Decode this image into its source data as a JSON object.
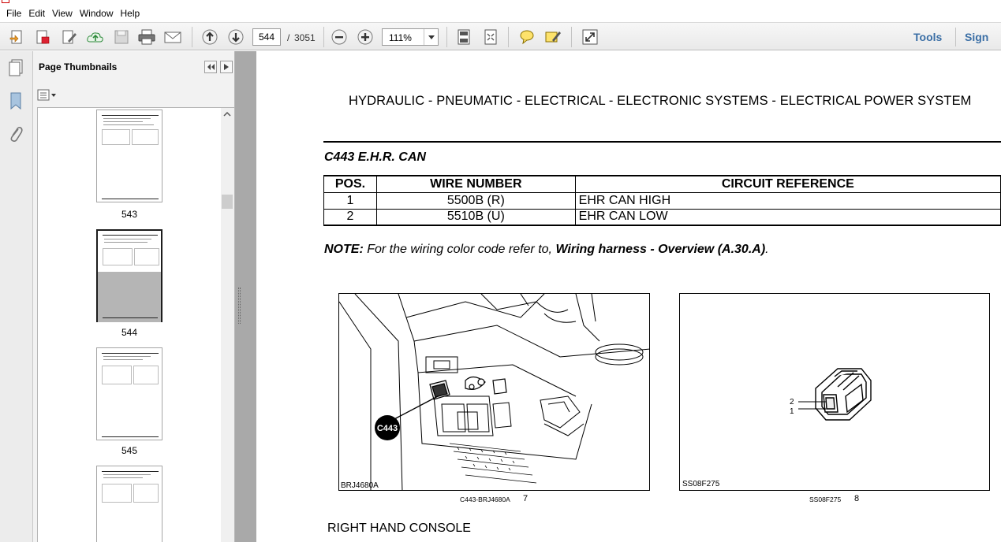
{
  "menu": [
    "File",
    "Edit",
    "View",
    "Window",
    "Help"
  ],
  "toolbar": {
    "current_page": "544",
    "page_separator": "/",
    "total_pages": "3051",
    "zoom": "111%",
    "tools_label": "Tools",
    "sign_label": "Sign"
  },
  "thumbnails": {
    "title": "Page Thumbnails",
    "items": [
      {
        "label": "543",
        "selected": false
      },
      {
        "label": "544",
        "selected": true
      },
      {
        "label": "545",
        "selected": false
      },
      {
        "label": "",
        "selected": false
      }
    ]
  },
  "document": {
    "header": "HYDRAULIC - PNEUMATIC - ELECTRICAL - ELECTRONIC SYSTEMS - ELECTRICAL POWER SYSTEM",
    "connector_title": "C443 E.H.R. CAN",
    "table": {
      "headers": [
        "POS.",
        "WIRE NUMBER",
        "CIRCUIT REFERENCE"
      ],
      "rows": [
        [
          "1",
          "5500B (R)",
          "EHR CAN HIGH"
        ],
        [
          "2",
          "5510B (U)",
          "EHR CAN LOW"
        ]
      ]
    },
    "note": {
      "label": "NOTE:",
      "text": " For the wiring color code refer to, ",
      "link": "Wiring harness - Overview (A.30.A)",
      "end": "."
    },
    "figures": [
      {
        "code": "BRJ4680A",
        "caption": "C443-BRJ4680A",
        "number": "7",
        "callout": "C443"
      },
      {
        "code": "SS08F275",
        "caption": "SS08F275",
        "number": "8",
        "pin_labels": [
          "2",
          "1"
        ]
      }
    ],
    "section_title": "RIGHT HAND CONSOLE"
  }
}
